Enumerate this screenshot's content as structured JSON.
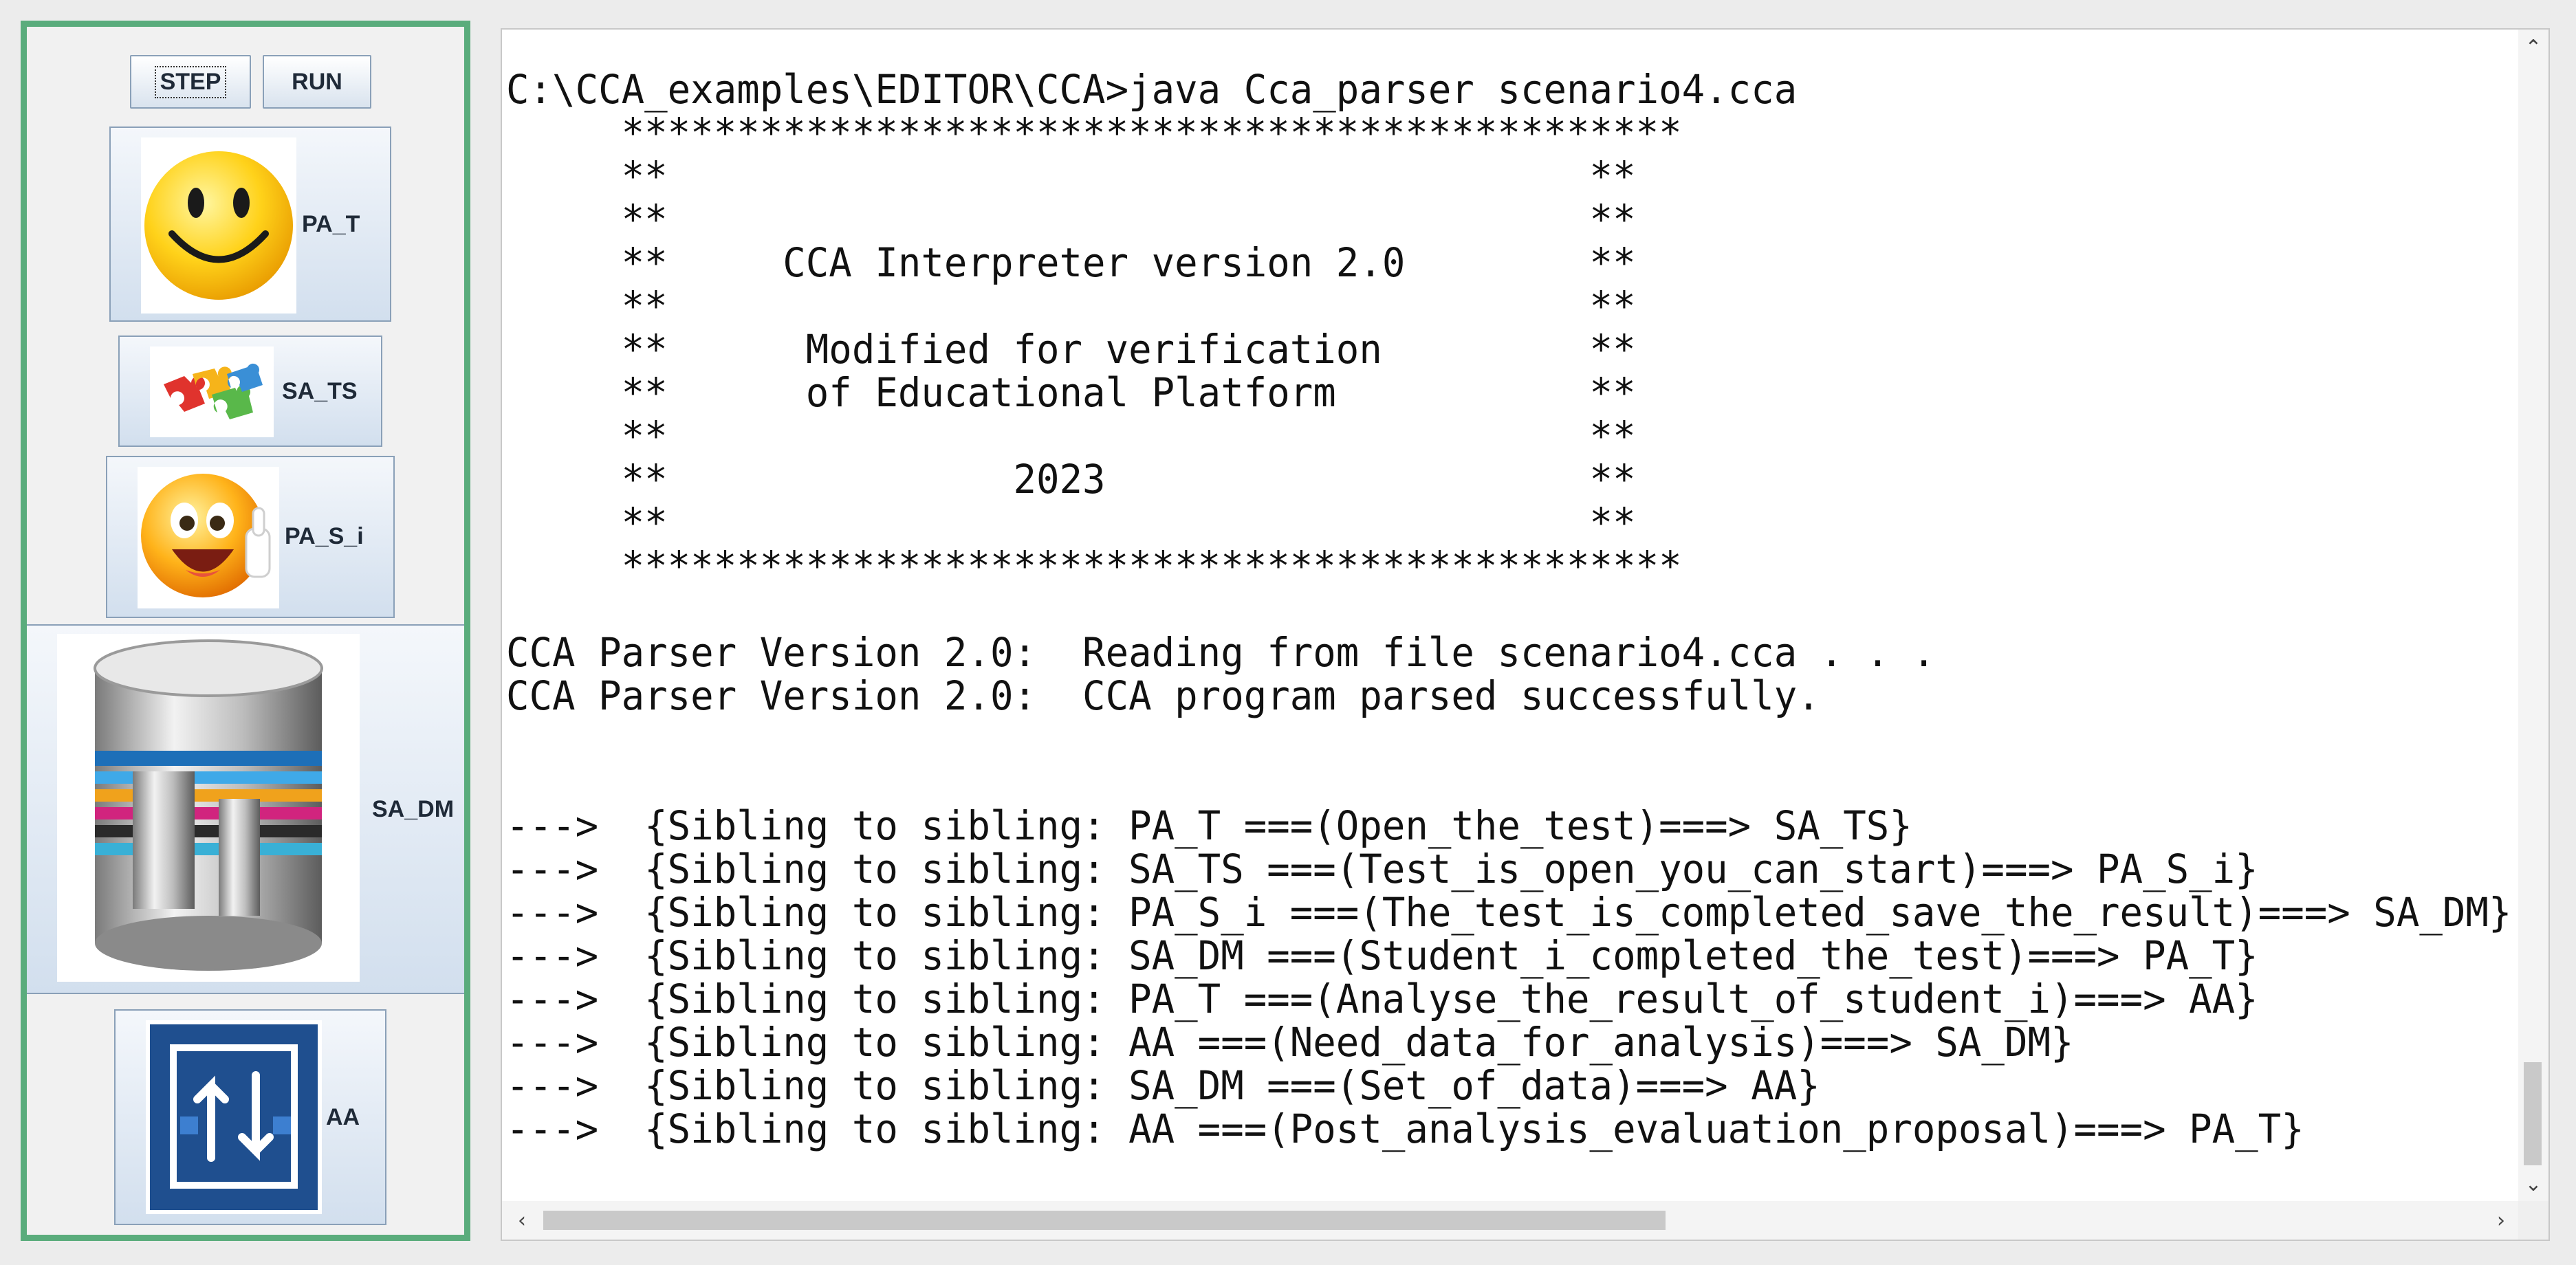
{
  "toolbar": {
    "step_label": "STEP",
    "run_label": "RUN"
  },
  "agents": [
    {
      "label": "PA_T",
      "icon": "smiley-face-icon"
    },
    {
      "label": "SA_TS",
      "icon": "puzzle-pieces-icon"
    },
    {
      "label": "PA_S_i",
      "icon": "thumbs-up-smiley-icon"
    },
    {
      "label": "SA_DM",
      "icon": "database-icon"
    },
    {
      "label": "AA",
      "icon": "analysis-arrows-icon"
    }
  ],
  "console": {
    "lines": [
      "C:\\CCA_examples\\EDITOR\\CCA>java Cca_parser scenario4.cca",
      "     **********************************************",
      "     **                                        **",
      "     **                                        **",
      "     **     CCA Interpreter version 2.0        **",
      "     **                                        **",
      "     **      Modified for verification         **",
      "     **      of Educational Platform           **",
      "     **                                        **",
      "     **               2023                     **",
      "     **                                        **",
      "     **********************************************",
      "",
      "CCA Parser Version 2.0:  Reading from file scenario4.cca . . .",
      "CCA Parser Version 2.0:  CCA program parsed successfully.",
      "",
      "",
      "--->  {Sibling to sibling: PA_T ===(Open_the_test)===> SA_TS}",
      "--->  {Sibling to sibling: SA_TS ===(Test_is_open_you_can_start)===> PA_S_i}",
      "--->  {Sibling to sibling: PA_S_i ===(The_test_is_completed_save_the_result)===> SA_DM}",
      "--->  {Sibling to sibling: SA_DM ===(Student_i_completed_the_test)===> PA_T}",
      "--->  {Sibling to sibling: PA_T ===(Analyse_the_result_of_student_i)===> AA}",
      "--->  {Sibling to sibling: AA ===(Need_data_for_analysis)===> SA_DM}",
      "--->  {Sibling to sibling: SA_DM ===(Set_of_data)===> AA}",
      "--->  {Sibling to sibling: AA ===(Post_analysis_evaluation_proposal)===> PA_T}"
    ]
  },
  "scrollbars": {
    "up_arrow": "⌃",
    "down_arrow": "⌄",
    "left_arrow": "‹",
    "right_arrow": "›"
  },
  "colors": {
    "panel_border": "#5aac7c",
    "button_gradient_end": "#d2dfee",
    "console_bg": "#ffffff"
  }
}
